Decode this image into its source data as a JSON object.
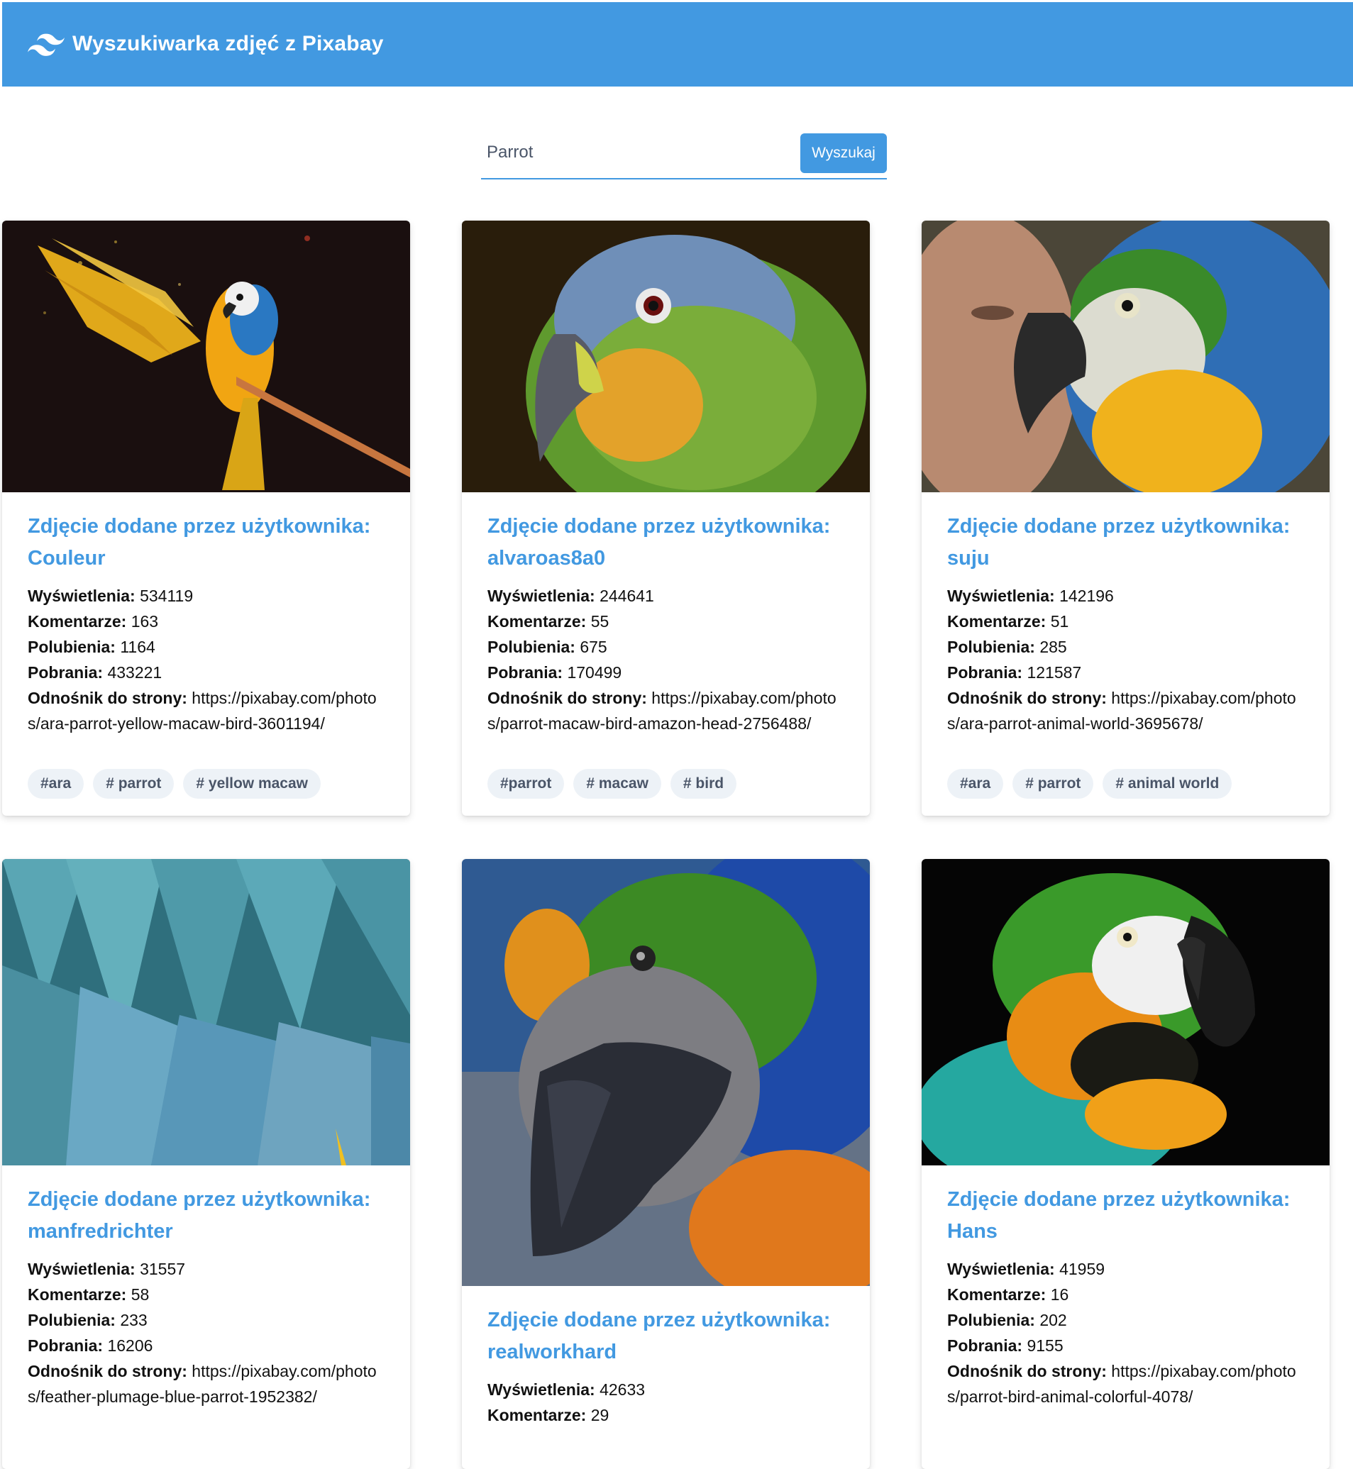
{
  "header": {
    "title": "Wyszukiwarka zdjęć z Pixabay",
    "brand_color": "#4299e1"
  },
  "search": {
    "value": "Parrot",
    "button_label": "Wyszukaj"
  },
  "labels": {
    "title_prefix": "Zdjęcie dodane przez użytkownika:",
    "views": "Wyświetlenia:",
    "comments": "Komentarze:",
    "likes": "Polubienia:",
    "downloads": "Pobrania:",
    "link": "Odnośnik do strony:"
  },
  "cards": [
    {
      "user": "Couleur",
      "views": "534119",
      "comments": "163",
      "likes": "1164",
      "downloads": "433221",
      "link": "https://pixabay.com/photos/ara-parrot-yellow-macaw-bird-3601194/",
      "tags": [
        "#ara",
        "# parrot",
        "# yellow macaw"
      ],
      "image": "macaw-wings-spread"
    },
    {
      "user": "alvaroas8a0",
      "views": "244641",
      "comments": "55",
      "likes": "675",
      "downloads": "170499",
      "link": "https://pixabay.com/photos/parrot-macaw-bird-amazon-head-2756488/",
      "tags": [
        "#parrot",
        "# macaw",
        "# bird"
      ],
      "image": "amazon-parrot-head"
    },
    {
      "user": "suju",
      "views": "142196",
      "comments": "51",
      "likes": "285",
      "downloads": "121587",
      "link": "https://pixabay.com/photos/ara-parrot-animal-world-3695678/",
      "tags": [
        "#ara",
        "# parrot",
        "# animal world"
      ],
      "image": "macaw-with-woman"
    },
    {
      "user": "manfredrichter",
      "views": "31557",
      "comments": "58",
      "likes": "233",
      "downloads": "16206",
      "link": "https://pixabay.com/photos/feather-plumage-blue-parrot-1952382/",
      "tags": [],
      "image": "blue-feathers"
    },
    {
      "user": "realworkhard",
      "views": "42633",
      "comments": "29",
      "tags": [],
      "image": "macaw-closeup-beak"
    },
    {
      "user": "Hans",
      "views": "41959",
      "comments": "16",
      "likes": "202",
      "downloads": "9155",
      "link": "https://pixabay.com/photos/parrot-bird-animal-colorful-4078/",
      "tags": [],
      "image": "green-macaw-dark"
    }
  ]
}
